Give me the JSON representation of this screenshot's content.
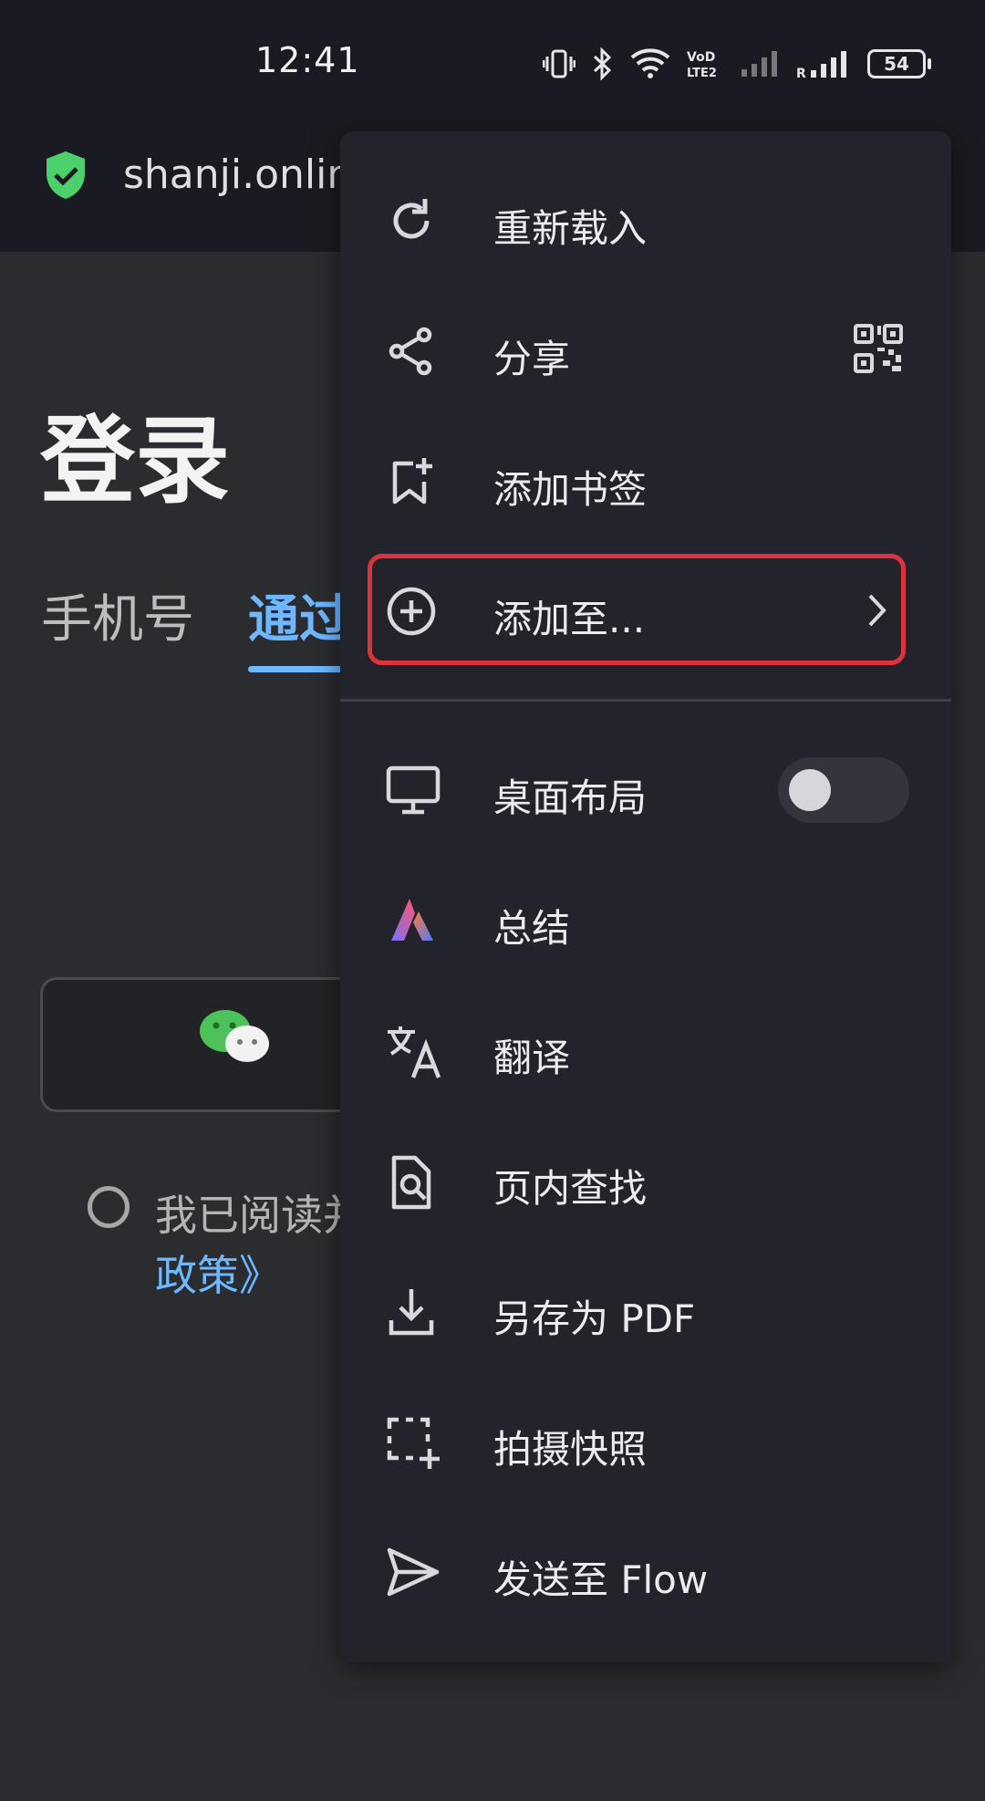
{
  "status_bar": {
    "time": "12:41",
    "battery": "54",
    "icons": [
      "vibrate-icon",
      "bluetooth-icon",
      "wifi-icon",
      "volte-icon",
      "signal-icon",
      "signal-roaming-icon",
      "battery-icon"
    ]
  },
  "url_bar": {
    "url": "shanji.online",
    "security_icon": "shield-check-icon",
    "security_color": "#4cd06b"
  },
  "page": {
    "title": "登录",
    "tab_phone": "手机号",
    "tab_verify": "通过",
    "agree_text": "我已阅读并",
    "agree_link": "政策》",
    "accent": "#6fb8ff"
  },
  "menu": {
    "items": [
      {
        "label": "重新载入",
        "icon": "reload-icon"
      },
      {
        "label": "分享",
        "icon": "share-icon",
        "extra_icon": "qr-code-icon"
      },
      {
        "label": "添加书签",
        "icon": "bookmark-add-icon"
      },
      {
        "label": "添加至...",
        "icon": "add-circle-icon",
        "extra_icon": "chevron-right-icon",
        "highlighted": true
      },
      {
        "label": "桌面布局",
        "icon": "desktop-icon",
        "toggle": false
      },
      {
        "label": "总结",
        "icon": "summary-app-icon"
      },
      {
        "label": "翻译",
        "icon": "translate-icon"
      },
      {
        "label": "页内查找",
        "icon": "find-in-page-icon"
      },
      {
        "label": "另存为 PDF",
        "icon": "download-icon"
      },
      {
        "label": "拍摄快照",
        "icon": "snapshot-icon"
      },
      {
        "label": "发送至 Flow",
        "icon": "send-icon"
      }
    ],
    "highlight_color": "#e0323a"
  }
}
